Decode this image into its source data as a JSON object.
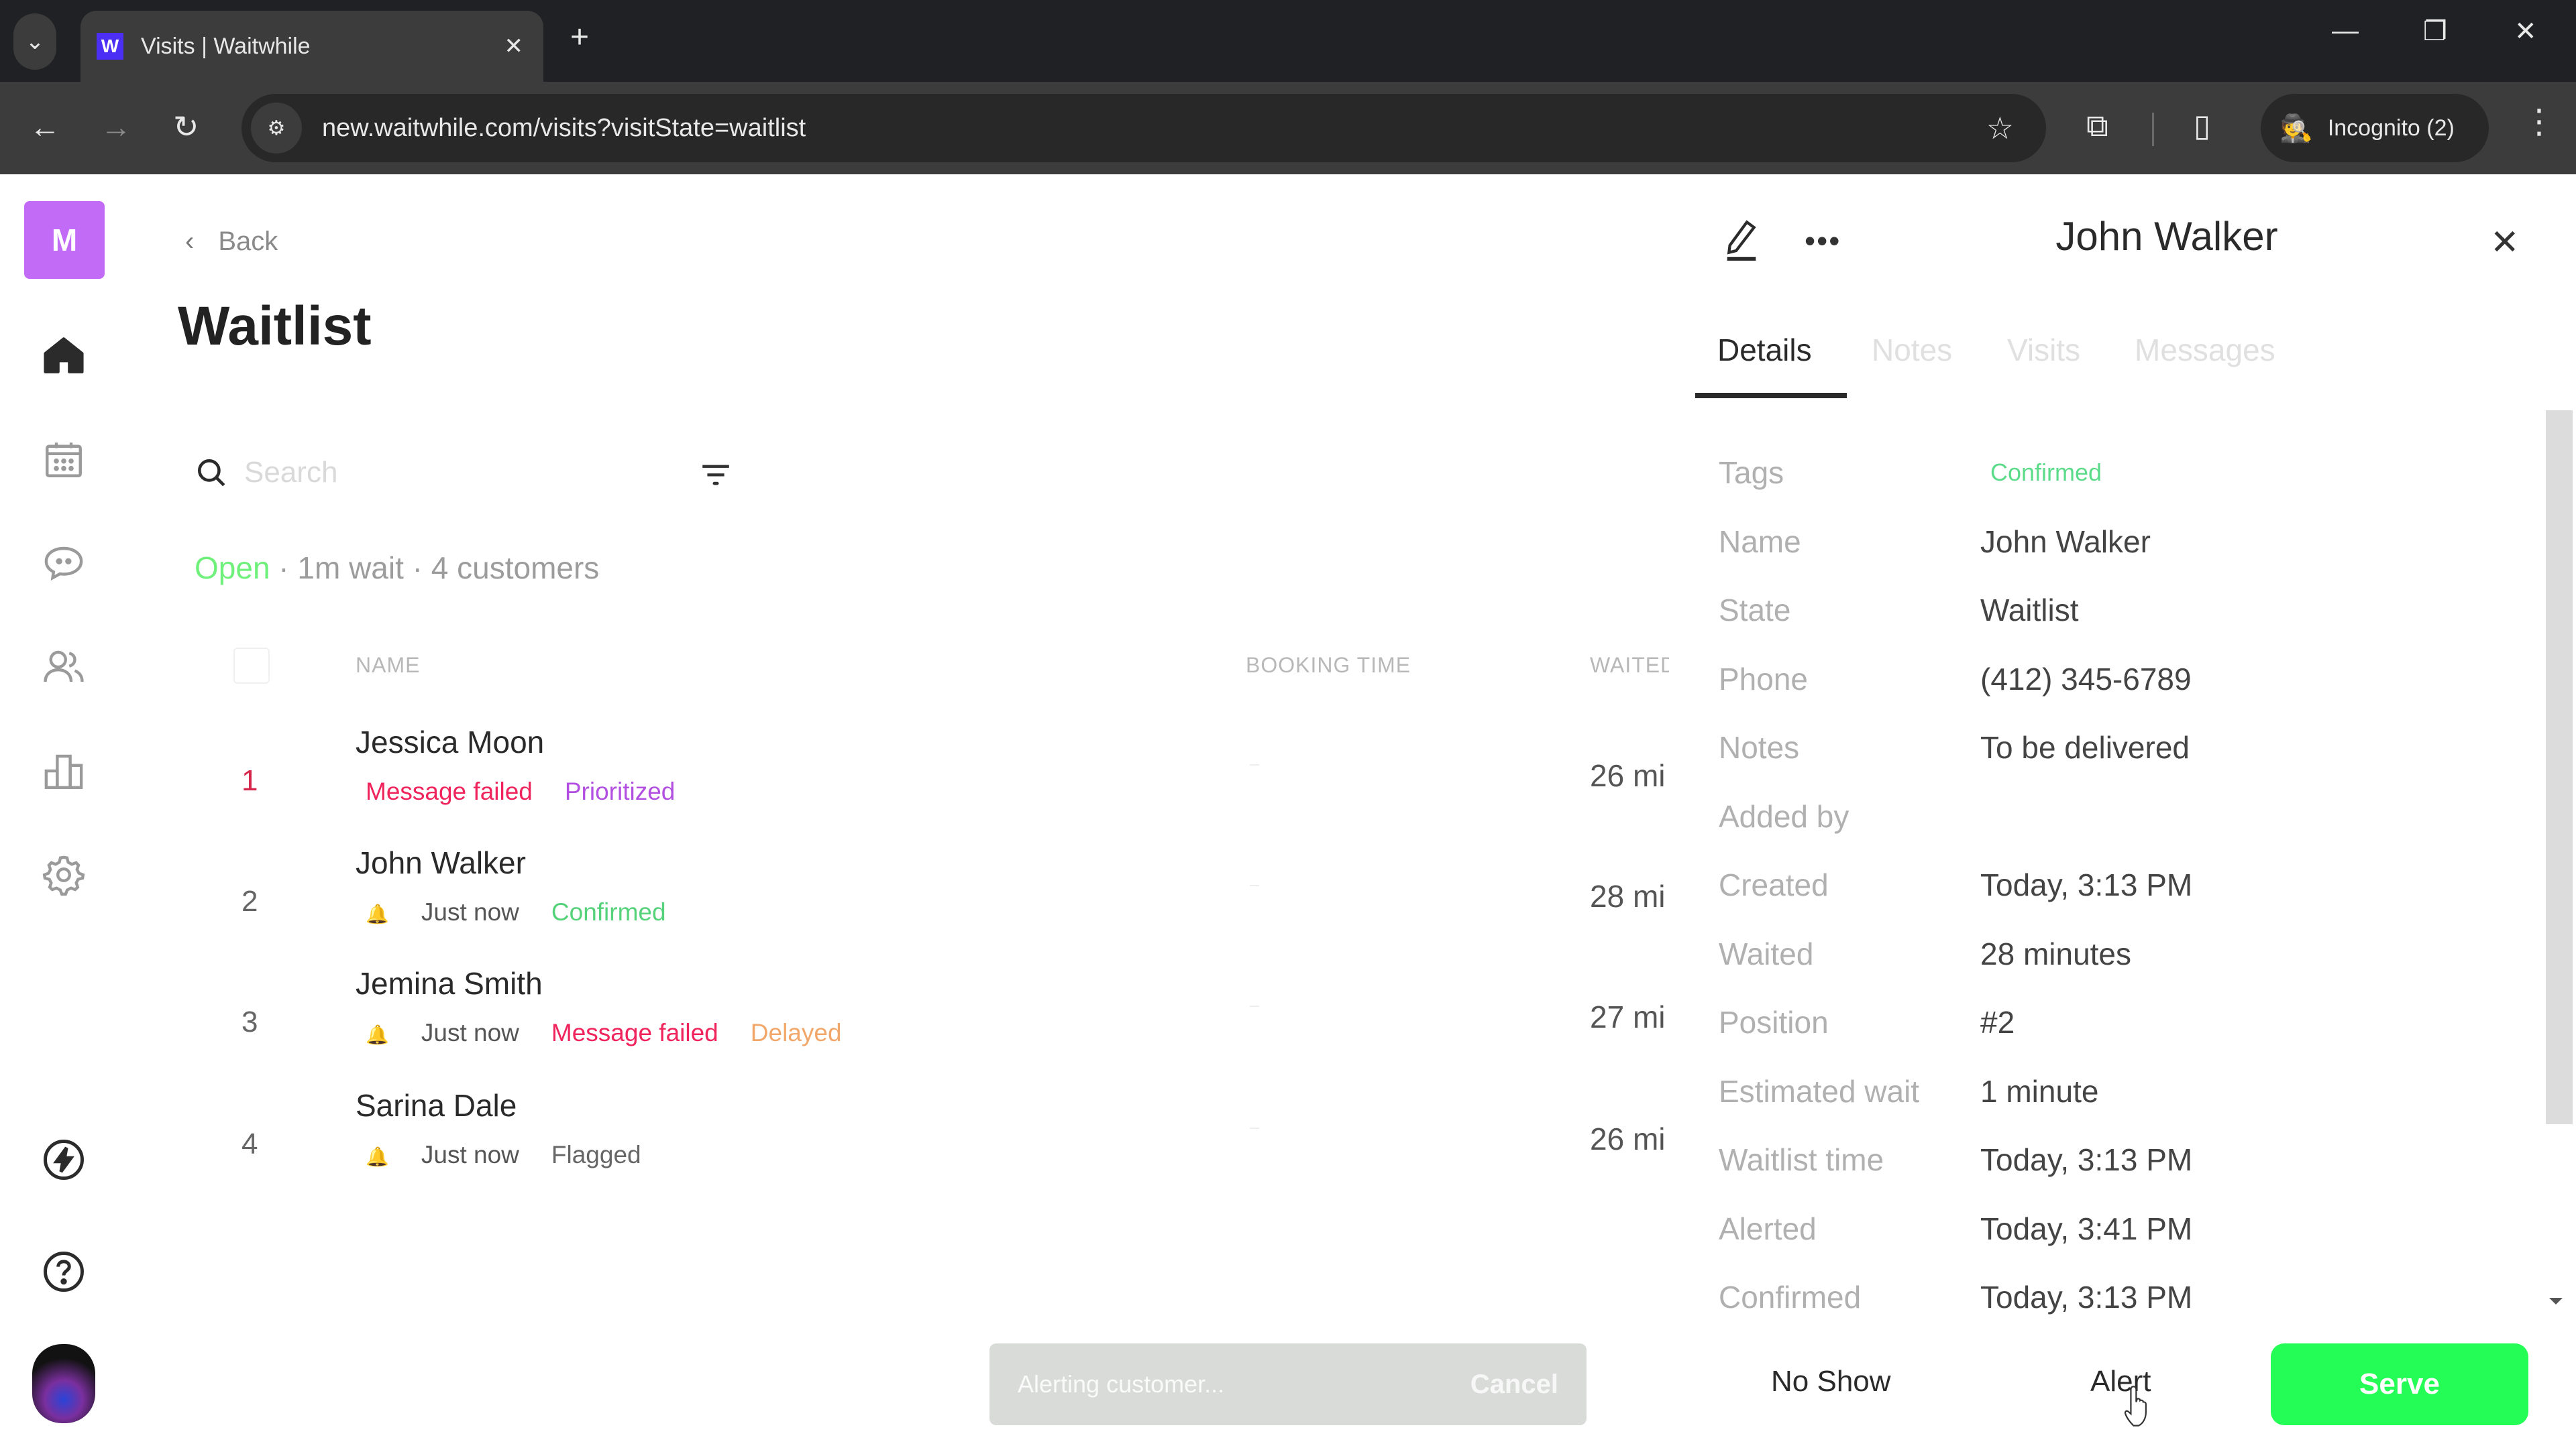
{
  "browser": {
    "tab_title": "Visits | Waitwhile",
    "favicon_letter": "W",
    "tab_close": "✕",
    "new_tab": "+",
    "url": "new.waitwhile.com/visits?visitState=waitlist",
    "incognito_label": "Incognito (2)",
    "window_controls": {
      "minimize": "—",
      "restore": "❐",
      "close": "✕"
    },
    "nav": {
      "back": "←",
      "forward": "→",
      "reload": "↻"
    },
    "icons": {
      "tab_search": "⌄",
      "site_info": "⚙",
      "bookmark": "☆",
      "extensions": "⧉",
      "side_panel": "▯",
      "incognito": "🕵",
      "menu": "⋮"
    }
  },
  "sidebar": {
    "logo_letter": "M",
    "items": [
      {
        "name": "home",
        "active": true
      },
      {
        "name": "calendar"
      },
      {
        "name": "messages"
      },
      {
        "name": "customers"
      },
      {
        "name": "analytics"
      },
      {
        "name": "settings"
      }
    ],
    "bottom": [
      {
        "name": "whats-new"
      },
      {
        "name": "help"
      },
      {
        "name": "user-avatar"
      }
    ]
  },
  "main": {
    "back_label": "Back",
    "back_icon": "‹",
    "title": "Waitlist",
    "search_placeholder": "Search",
    "status": {
      "open": "Open",
      "rest": " · 1m wait · 4 customers"
    },
    "columns": {
      "name": "NAME",
      "booking_time": "BOOKING TIME",
      "waited": "WAITED"
    },
    "rows": [
      {
        "position": "1",
        "name": "Jessica Moon",
        "tags": [
          {
            "text": "Message failed",
            "kind": "failed"
          },
          {
            "text": "Prioritized",
            "kind": "prioritized"
          }
        ],
        "alert": null,
        "booking_time": "-",
        "waited": "26 mi"
      },
      {
        "position": "2",
        "name": "John Walker",
        "alert": "Just now",
        "tags": [
          {
            "text": "Confirmed",
            "kind": "confirmed"
          }
        ],
        "booking_time": "-",
        "waited": "28 mi"
      },
      {
        "position": "3",
        "name": "Jemina Smith",
        "alert": "Just now",
        "tags": [
          {
            "text": "Message failed",
            "kind": "failed"
          },
          {
            "text": "Delayed",
            "kind": "delayed"
          }
        ],
        "booking_time": "-",
        "waited": "27 mi"
      },
      {
        "position": "4",
        "name": "Sarina Dale",
        "alert": "Just now",
        "tags": [
          {
            "text": "Flagged",
            "kind": "flagged"
          }
        ],
        "booking_time": "-",
        "waited": "26 mi"
      }
    ]
  },
  "panel": {
    "title": "John Walker",
    "more_icon": "•••",
    "close_icon": "✕",
    "tabs": [
      {
        "label": "Details",
        "active": true
      },
      {
        "label": "Notes"
      },
      {
        "label": "Visits"
      },
      {
        "label": "Messages"
      }
    ],
    "details": [
      {
        "label": "Tags",
        "value": "Confirmed",
        "is_tag": true
      },
      {
        "label": "Name",
        "value": "John Walker"
      },
      {
        "label": "State",
        "value": "Waitlist"
      },
      {
        "label": "Phone",
        "value": "(412) 345-6789"
      },
      {
        "label": "Notes",
        "value": "To be delivered"
      },
      {
        "label": "Added by",
        "value": ""
      },
      {
        "label": "Created",
        "value": "Today, 3:13 PM"
      },
      {
        "label": "Waited",
        "value": "28 minutes"
      },
      {
        "label": "Position",
        "value": "#2"
      },
      {
        "label": "Estimated wait",
        "value": "1 minute"
      },
      {
        "label": "Waitlist time",
        "value": "Today, 3:13 PM"
      },
      {
        "label": "Alerted",
        "value": "Today, 3:41 PM"
      },
      {
        "label": "Confirmed",
        "value": "Today, 3:13 PM"
      }
    ]
  },
  "actions": {
    "alerting_text": "Alerting customer...",
    "cancel_label": "Cancel",
    "no_show_label": "No Show",
    "alert_label": "Alert",
    "serve_label": "Serve"
  },
  "colors": {
    "brand_logo": "#c26bf7",
    "serve_green": "#23fd55",
    "open_green": "#6ef07a",
    "failed": "#f0245c",
    "prioritized": "#b24fe0",
    "confirmed": "#55d27a",
    "delayed": "#f2a76a",
    "bell": "#f2d600"
  }
}
